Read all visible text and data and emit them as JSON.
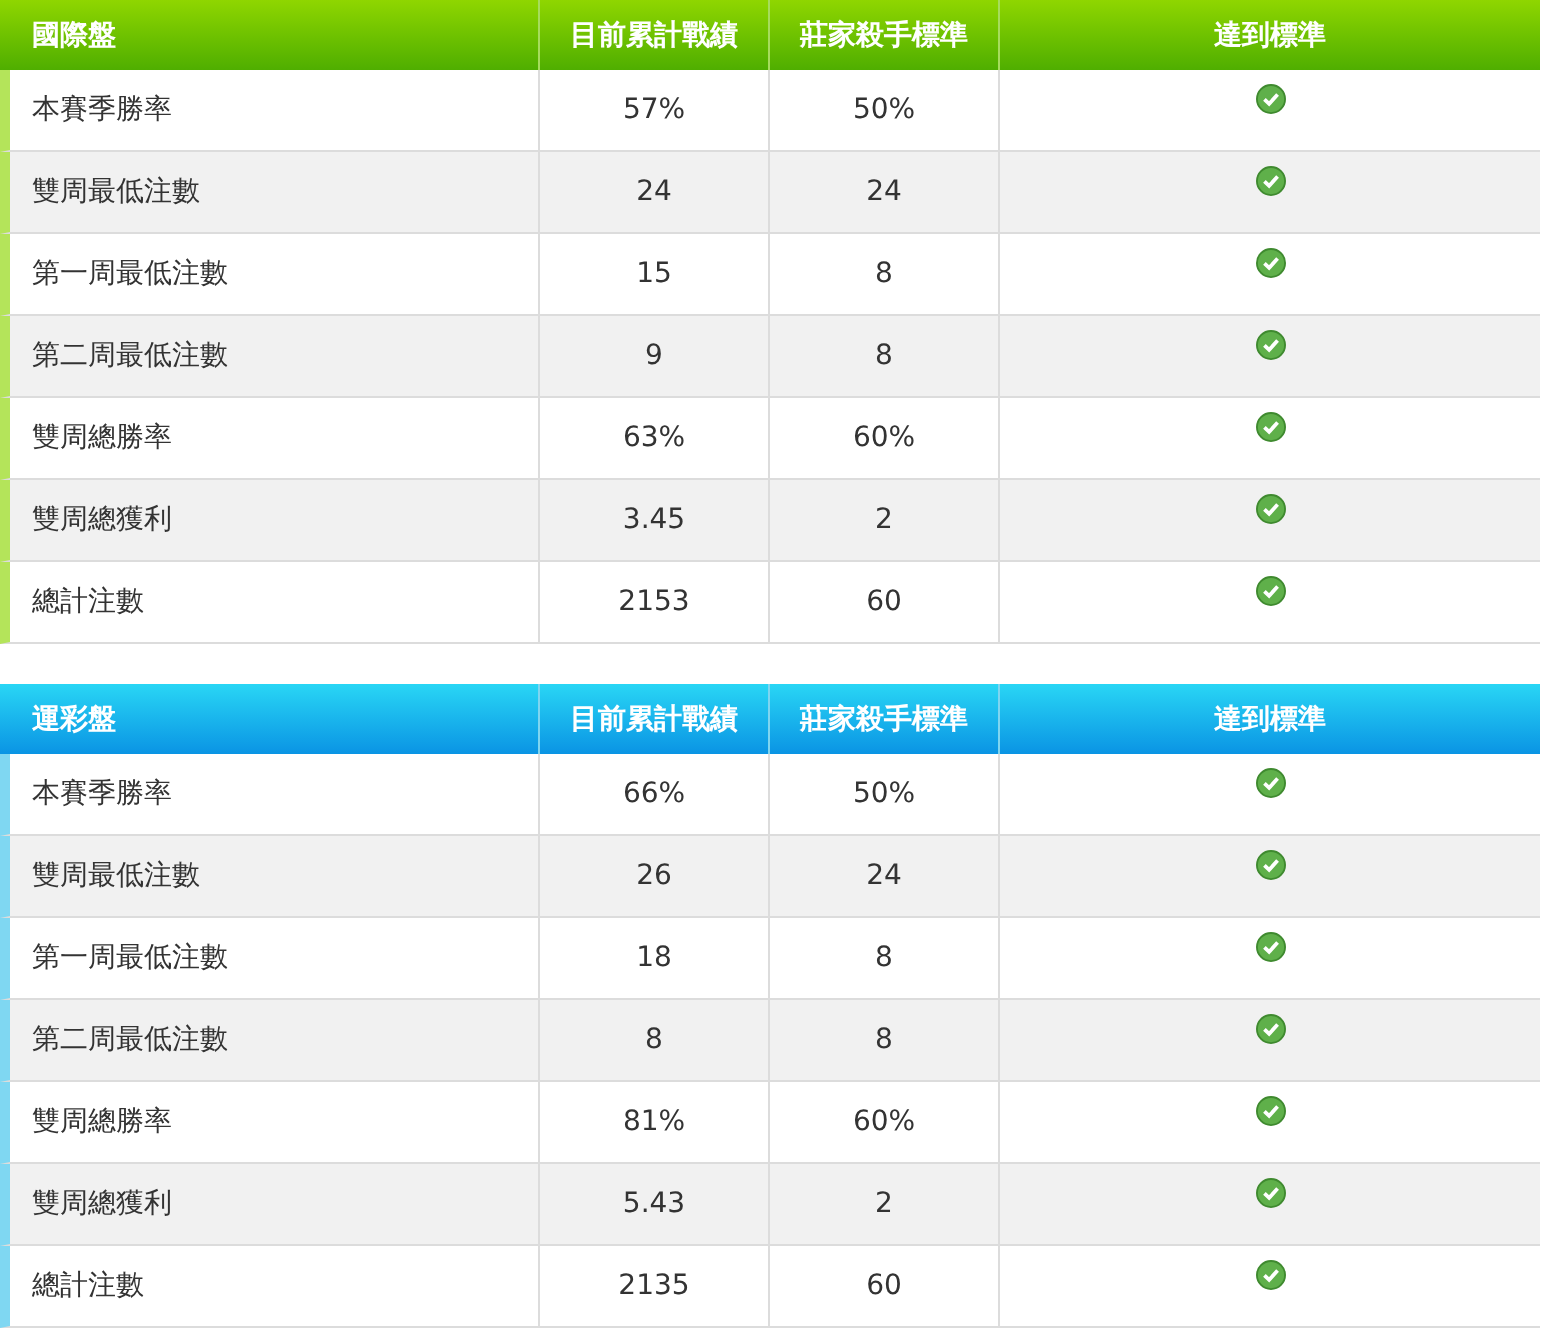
{
  "tables": [
    {
      "kind": "green",
      "columns": [
        "國際盤",
        "目前累計戰績",
        "莊家殺手標準",
        "達到標準"
      ],
      "rows": [
        {
          "label": "本賽季勝率",
          "current": "57%",
          "standard": "50%",
          "met": true
        },
        {
          "label": "雙周最低注數",
          "current": "24",
          "standard": "24",
          "met": true
        },
        {
          "label": "第一周最低注數",
          "current": "15",
          "standard": "8",
          "met": true
        },
        {
          "label": "第二周最低注數",
          "current": "9",
          "standard": "8",
          "met": true
        },
        {
          "label": "雙周總勝率",
          "current": "63%",
          "standard": "60%",
          "met": true
        },
        {
          "label": "雙周總獲利",
          "current": "3.45",
          "standard": "2",
          "met": true
        },
        {
          "label": "總計注數",
          "current": "2153",
          "standard": "60",
          "met": true
        }
      ]
    },
    {
      "kind": "blue",
      "columns": [
        "運彩盤",
        "目前累計戰績",
        "莊家殺手標準",
        "達到標準"
      ],
      "rows": [
        {
          "label": "本賽季勝率",
          "current": "66%",
          "standard": "50%",
          "met": true
        },
        {
          "label": "雙周最低注數",
          "current": "26",
          "standard": "24",
          "met": true
        },
        {
          "label": "第一周最低注數",
          "current": "18",
          "standard": "8",
          "met": true
        },
        {
          "label": "第二周最低注數",
          "current": "8",
          "standard": "8",
          "met": true
        },
        {
          "label": "雙周總勝率",
          "current": "81%",
          "standard": "60%",
          "met": true
        },
        {
          "label": "雙周總獲利",
          "current": "5.43",
          "standard": "2",
          "met": true
        },
        {
          "label": "總計注數",
          "current": "2135",
          "standard": "60",
          "met": true
        }
      ]
    }
  ]
}
